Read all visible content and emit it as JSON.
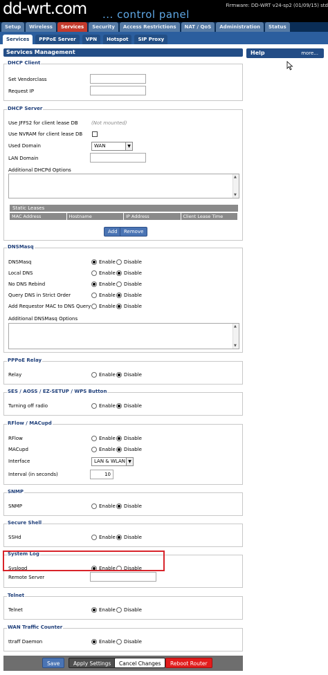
{
  "header": {
    "logo": "dd-wrt.com",
    "subtitle": "... control panel",
    "firmware": "Firmware: DD-WRT v24-sp2 (01/09/15) std"
  },
  "tabs": [
    "Setup",
    "Wireless",
    "Services",
    "Security",
    "Access Restrictions",
    "NAT / QoS",
    "Administration",
    "Status"
  ],
  "subtabs": [
    "Services",
    "PPPoE Server",
    "VPN",
    "Hotspot",
    "SIP Proxy"
  ],
  "page_title": "Services Management",
  "help": {
    "title": "Help",
    "more": "more..."
  },
  "dhcp_client": {
    "legend": "DHCP Client",
    "vendorclass_label": "Set Vendorclass",
    "request_ip_label": "Request IP"
  },
  "dhcp_server": {
    "legend": "DHCP Server",
    "jffs2_label": "Use JFFS2 for client lease DB",
    "jffs2_status": "(Not mounted)",
    "nvram_label": "Use NVRAM for client lease DB",
    "domain_label": "Used Domain",
    "domain_value": "WAN",
    "lan_domain_label": "LAN Domain",
    "additional_label": "Additional DHCPd Options",
    "static_leases": "Static Leases",
    "columns": [
      "MAC Address",
      "Hostname",
      "IP Address",
      "Client Lease Time"
    ],
    "add": "Add",
    "remove": "Remove"
  },
  "dnsmasq": {
    "legend": "DNSMasq",
    "rows": [
      {
        "label": "DNSMasq",
        "enabled": true
      },
      {
        "label": "Local DNS",
        "enabled": false
      },
      {
        "label": "No DNS Rebind",
        "enabled": true
      },
      {
        "label": "Query DNS in Strict Order",
        "enabled": false
      },
      {
        "label": "Add Requestor MAC to DNS Query",
        "enabled": false
      }
    ],
    "additional_label": "Additional DNSMasq Options"
  },
  "pppoe_relay": {
    "legend": "PPPoE Relay",
    "label": "Relay",
    "enabled": false
  },
  "ses": {
    "legend": "SES / AOSS / EZ-SETUP / WPS Button",
    "label": "Turning off radio",
    "enabled": false
  },
  "rflow": {
    "legend": "RFlow / MACupd",
    "rflow_label": "RFlow",
    "rflow_enabled": false,
    "macupd_label": "MACupd",
    "macupd_enabled": false,
    "interface_label": "Interface",
    "interface_value": "LAN & WLAN",
    "interval_label": "Interval (in seconds)",
    "interval_value": "10"
  },
  "snmp": {
    "legend": "SNMP",
    "label": "SNMP",
    "enabled": false
  },
  "ssh": {
    "legend": "Secure Shell",
    "label": "SSHd",
    "enabled": false
  },
  "syslog": {
    "legend": "System Log",
    "label": "Syslogd",
    "enabled": true,
    "remote_label": "Remote Server"
  },
  "telnet": {
    "legend": "Telnet",
    "label": "Telnet",
    "enabled": true
  },
  "wan_traffic": {
    "legend": "WAN Traffic Counter",
    "label": "ttraff Daemon",
    "enabled": true
  },
  "options": {
    "enable": "Enable",
    "disable": "Disable"
  },
  "buttons": {
    "save": "Save",
    "apply": "Apply Settings",
    "cancel": "Cancel Changes",
    "reboot": "Reboot Router"
  },
  "colors": {
    "accent": "#234d86",
    "active_tab": "#c33a2c",
    "reboot": "#e21c1c",
    "highlight": "#d8232a"
  }
}
